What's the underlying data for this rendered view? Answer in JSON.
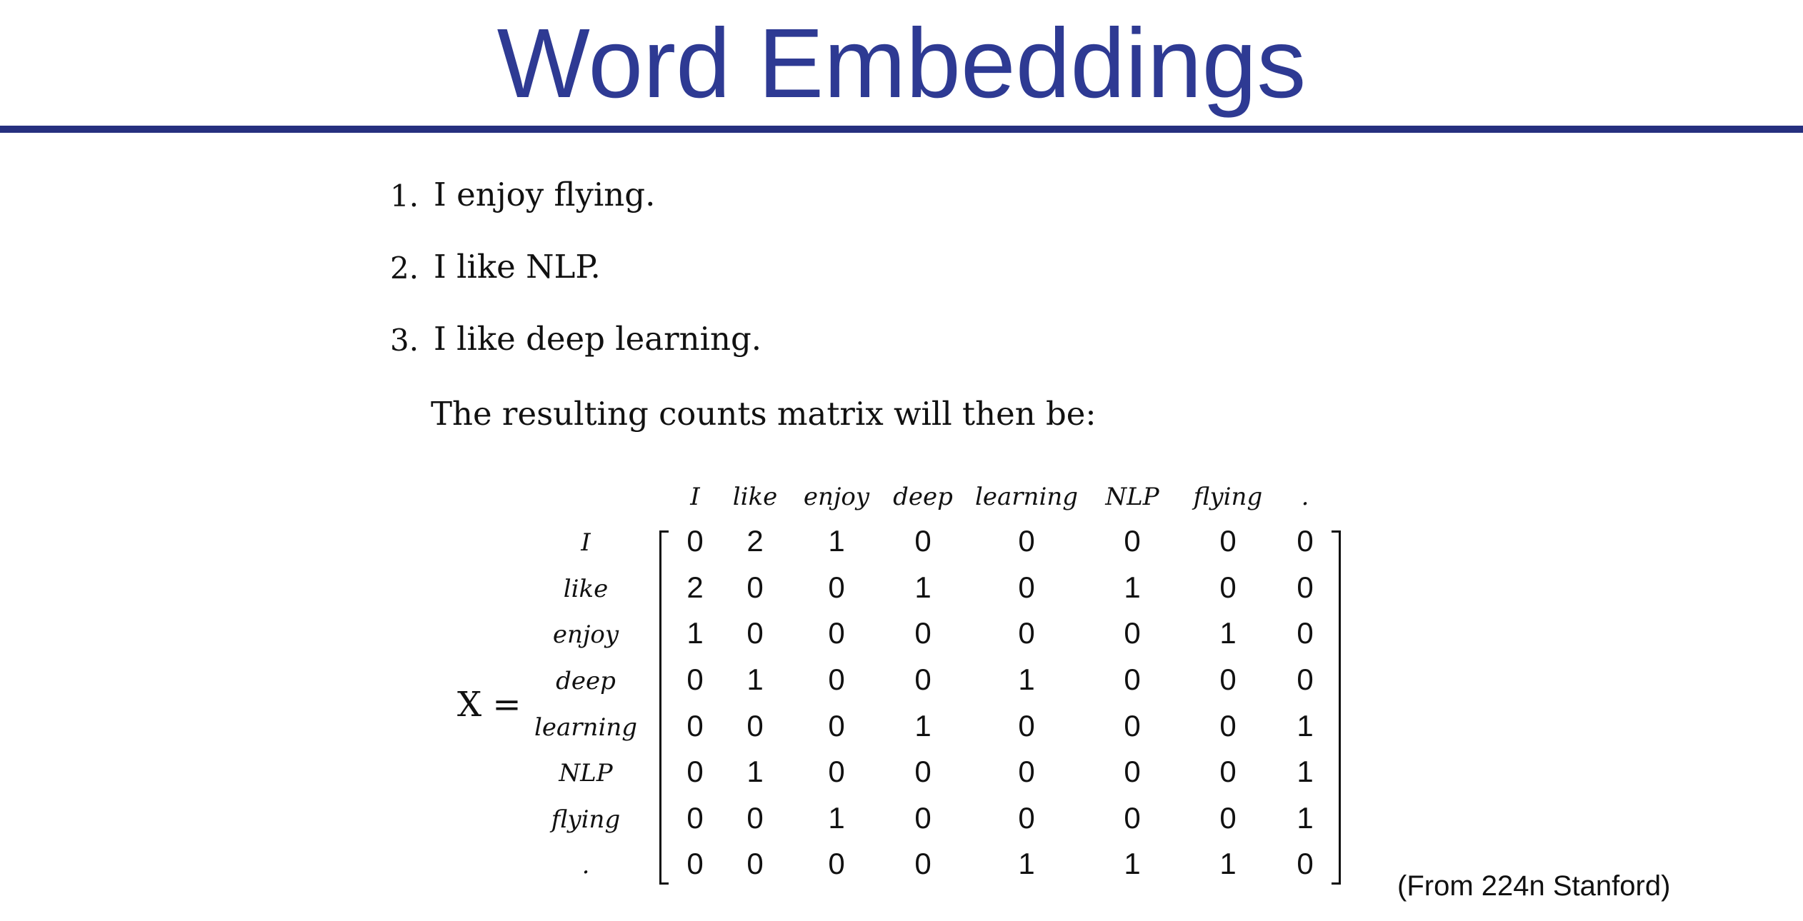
{
  "title": "Word Embeddings",
  "sentences": [
    {
      "number": "1.",
      "text": "I enjoy flying."
    },
    {
      "number": "2.",
      "text": "I like NLP."
    },
    {
      "number": "3.",
      "text": "I like deep learning."
    }
  ],
  "intro_text": "The resulting counts matrix will then be:",
  "matrix": {
    "label": "X =",
    "columns": [
      "I",
      "like",
      "enjoy",
      "deep",
      "learning",
      "NLP",
      "flying",
      "."
    ],
    "rows": [
      "I",
      "like",
      "enjoy",
      "deep",
      "learning",
      "NLP",
      "flying",
      "."
    ],
    "values": [
      [
        0,
        2,
        1,
        0,
        0,
        0,
        0,
        0
      ],
      [
        2,
        0,
        0,
        1,
        0,
        1,
        0,
        0
      ],
      [
        1,
        0,
        0,
        0,
        0,
        0,
        1,
        0
      ],
      [
        0,
        1,
        0,
        0,
        1,
        0,
        0,
        0
      ],
      [
        0,
        0,
        0,
        1,
        0,
        0,
        0,
        1
      ],
      [
        0,
        1,
        0,
        0,
        0,
        0,
        0,
        1
      ],
      [
        0,
        0,
        1,
        0,
        0,
        0,
        0,
        1
      ],
      [
        0,
        0,
        0,
        0,
        1,
        1,
        1,
        0
      ]
    ]
  },
  "source_note": "(From 224n Stanford)"
}
